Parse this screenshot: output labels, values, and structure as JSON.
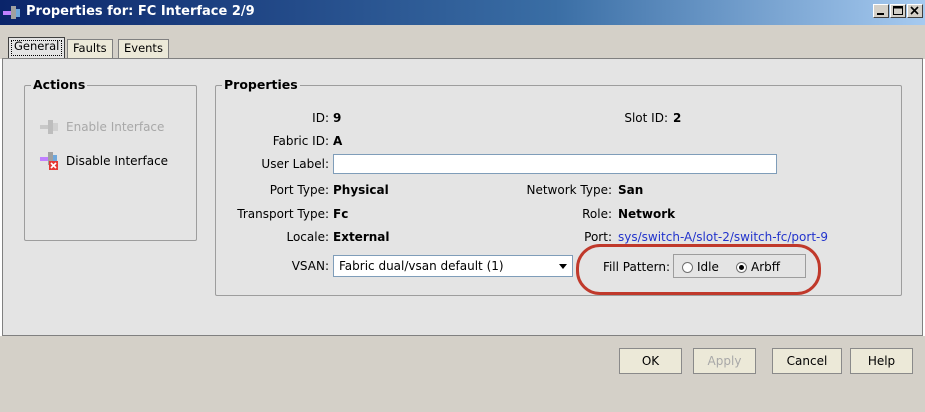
{
  "window": {
    "title": "Properties for: FC Interface 2/9"
  },
  "tabs": [
    {
      "label": "General"
    },
    {
      "label": "Faults"
    },
    {
      "label": "Events"
    }
  ],
  "actions": {
    "title": "Actions",
    "enable_interface": "Enable Interface",
    "disable_interface": "Disable Interface"
  },
  "properties": {
    "title": "Properties",
    "id_label": "ID:",
    "id_value": "9",
    "slot_id_label": "Slot ID:",
    "slot_id_value": "2",
    "fabric_id_label": "Fabric ID:",
    "fabric_id_value": "A",
    "user_label_label": "User Label:",
    "user_label_value": "",
    "port_type_label": "Port Type:",
    "port_type_value": "Physical",
    "network_type_label": "Network Type:",
    "network_type_value": "San",
    "transport_type_label": "Transport Type:",
    "transport_type_value": "Fc",
    "role_label": "Role:",
    "role_value": "Network",
    "locale_label": "Locale:",
    "locale_value": "External",
    "port_label": "Port:",
    "port_value": "sys/switch-A/slot-2/switch-fc/port-9",
    "vsan_label": "VSAN:",
    "vsan_value": "Fabric dual/vsan default (1)",
    "fill_pattern_label": "Fill Pattern:",
    "fill_pattern_options": [
      "Idle",
      "Arbff"
    ],
    "fill_pattern_selected": "Arbff"
  },
  "buttons": {
    "ok": "OK",
    "apply": "Apply",
    "cancel": "Cancel",
    "help": "Help"
  },
  "colors": {
    "highlight": "#c0392b",
    "link": "#2233cc"
  }
}
